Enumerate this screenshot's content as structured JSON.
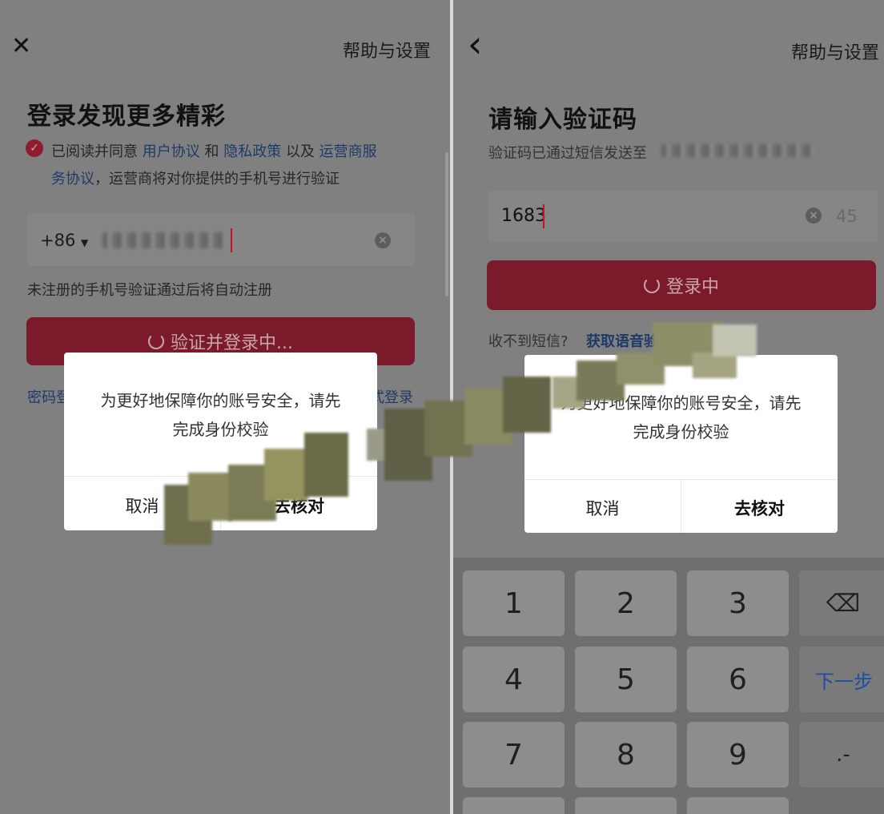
{
  "left": {
    "close_icon": "✕",
    "help_link": "帮助与设置",
    "title": "登录发现更多精彩",
    "agreement": {
      "prefix": "已阅读并同意",
      "user_agreement": "用户协议",
      "and1": "和",
      "privacy_policy": "隐私政策",
      "and2": "以及",
      "carrier_agreement_line1": "运营商服",
      "carrier_agreement_line2": "务协议",
      "suffix": "，运营商将对你提供的手机号进行验证"
    },
    "country_code": "+86",
    "hint": "未注册的手机号验证通过后将自动注册",
    "login_button": "验证并登录中...",
    "bottom_left_link": "密码登",
    "bottom_right_link": "式登录",
    "dialog": {
      "message_line1": "为更好地保障你的账号安全，请先",
      "message_line2": "完成身份校验",
      "cancel": "取消",
      "confirm": "去核对"
    }
  },
  "right": {
    "back_icon": "‹",
    "help_link": "帮助与设置",
    "title": "请输入验证码",
    "subtitle": "验证码已通过短信发送至",
    "code_value": "1683",
    "countdown": "45",
    "login_button": "登录中",
    "no_sms": "收不到短信?",
    "voice_code": "获取语音验",
    "dialog": {
      "message_line1": "为更好地保障你的账号安全，请先",
      "message_line2": "完成身份校验",
      "cancel": "取消",
      "confirm": "去核对"
    },
    "keypad": {
      "keys": [
        "1",
        "2",
        "3",
        "4",
        "5",
        "6",
        "7",
        "8",
        "9"
      ],
      "next": "下一步",
      "dot": ".-",
      "backspace_icon": "⌫"
    }
  },
  "colors": {
    "accent": "#7b1a2a",
    "link": "#1d3b67",
    "caret": "#c1122e"
  }
}
